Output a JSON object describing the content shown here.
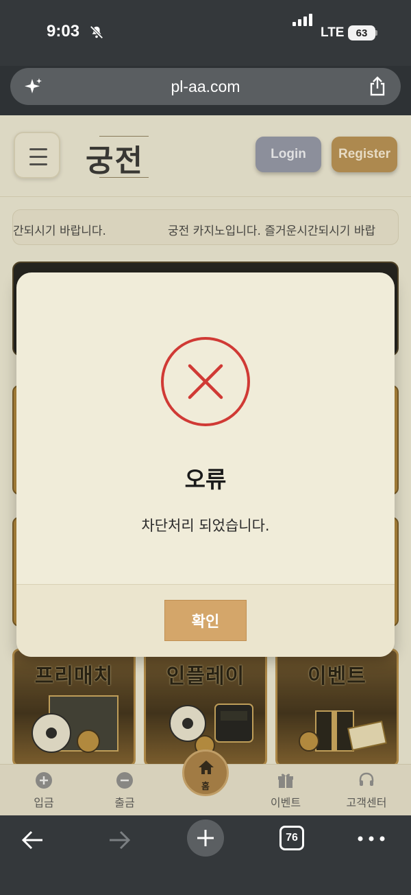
{
  "status_bar": {
    "time": "9:03",
    "carrier": "LTE",
    "battery": "63"
  },
  "browser": {
    "url": "pl-aa.com",
    "tab_count": "76"
  },
  "site": {
    "logo": "궁전",
    "login_label": "Login",
    "register_label": "Register",
    "marquee_part1": "간되시기 바랍니다.",
    "marquee_part2": "궁전 카지노입니다. 즐거운시간되시기 바랍",
    "game_cards": [
      {
        "title": "프리매치"
      },
      {
        "title": "인플레이"
      },
      {
        "title": "이벤트"
      }
    ],
    "bottom_nav": {
      "deposit": "입금",
      "withdraw": "출금",
      "home": "홈",
      "event": "이벤트",
      "support": "고객센터"
    }
  },
  "modal": {
    "title": "오류",
    "message": "차단처리 되었습니다.",
    "confirm_label": "확인"
  },
  "colors": {
    "accent_gold": "#d4a66a",
    "error_red": "#d03a35",
    "modal_bg": "#f0ecd9"
  }
}
